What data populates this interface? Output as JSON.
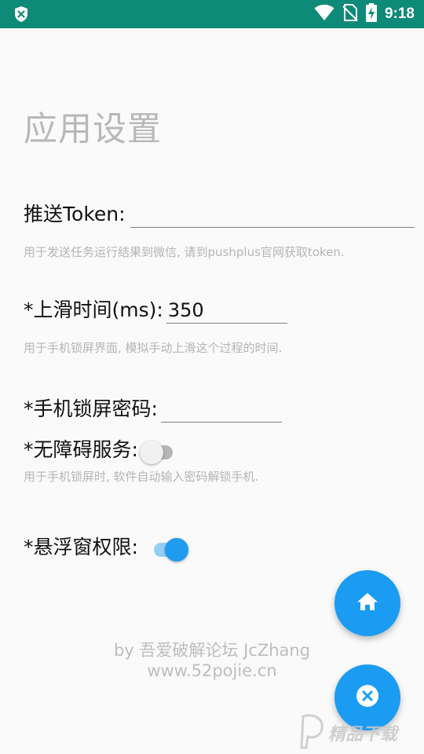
{
  "status_bar": {
    "time": "9:18",
    "icons": [
      "shield-x-icon",
      "wifi-icon",
      "no-sim-icon",
      "battery-charging-icon"
    ]
  },
  "page": {
    "title": "应用设置"
  },
  "token": {
    "label": "推送Token:",
    "value": "",
    "hint": "用于发送任务运行结果到微信, 请到pushplus官网获取token."
  },
  "swipe": {
    "label": "*上滑时间(ms):",
    "value": "350",
    "hint": "用于手机锁屏界面, 模拟手动上滑这个过程的时间."
  },
  "lock_password": {
    "label": "*手机锁屏密码:",
    "value": ""
  },
  "accessibility": {
    "label": "*无障碍服务:",
    "enabled": false,
    "hint": "用于手机锁屏时, 软件自动输入密码解锁手机."
  },
  "floating_window": {
    "label": "*悬浮窗权限:",
    "enabled": true
  },
  "credits": {
    "line1": "by 吾爱破解论坛 JcZhang",
    "line2": "www.52pojie.cn"
  },
  "fabs": {
    "home_icon": "home-icon",
    "close_icon": "close-circle-icon"
  },
  "watermark": {
    "text": "精品下载"
  },
  "colors": {
    "status_bar": "#0d8a78",
    "accent": "#1a9cf2",
    "hint_text": "#b5b5b5",
    "title_text": "#b8b8b8"
  }
}
